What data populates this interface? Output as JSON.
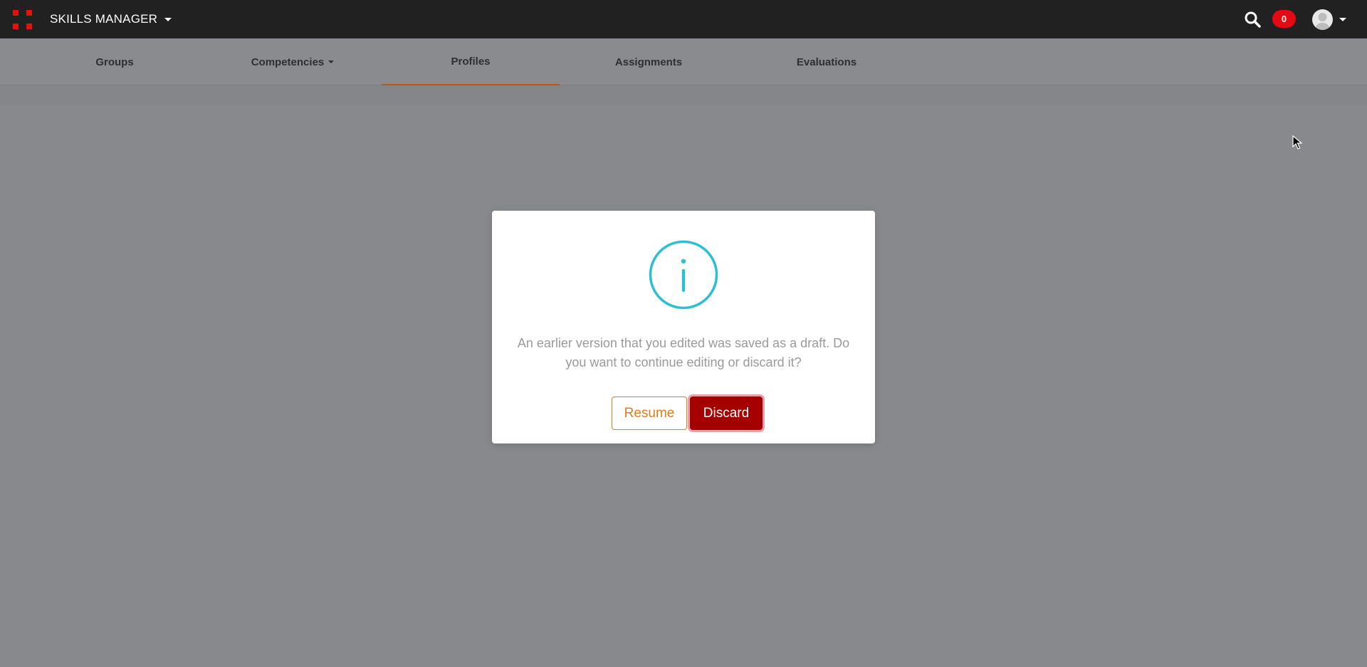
{
  "app": {
    "title": "SKILLS MANAGER",
    "logo_icon": "grid-logo-icon",
    "accent_color": "#e3130b"
  },
  "header": {
    "notification_count": "0",
    "search_icon": "search-icon",
    "avatar_icon": "user-avatar-icon"
  },
  "nav": {
    "tabs": [
      {
        "label": "Groups",
        "active": false
      },
      {
        "label": "Competencies",
        "active": false,
        "has_dropdown": true
      },
      {
        "label": "Profiles",
        "active": true
      },
      {
        "label": "Assignments",
        "active": false
      },
      {
        "label": "Evaluations",
        "active": false
      }
    ],
    "active_indicator_color": "#b35a1a"
  },
  "dialog": {
    "icon": "info-icon",
    "icon_color": "#2bbfd1",
    "message": "An earlier version that you edited was saved as a draft. Do you want to continue editing or discard it?",
    "resume_label": "Resume",
    "discard_label": "Discard",
    "resume_color": "#e07b1e",
    "discard_color": "#a50000"
  }
}
